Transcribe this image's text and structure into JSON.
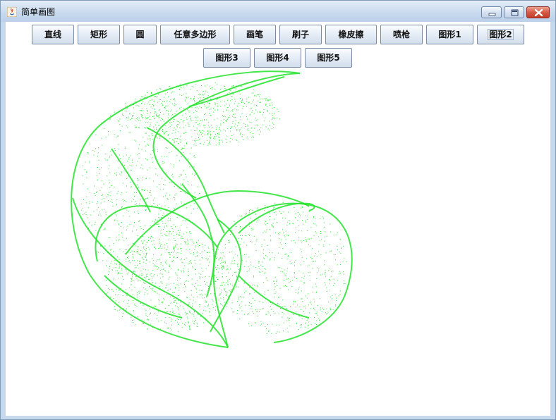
{
  "window": {
    "title": "简单画图",
    "controls": [
      "minimize-icon",
      "maximize-icon",
      "close-icon"
    ]
  },
  "toolbar": {
    "row1": [
      "直线",
      "矩形",
      "圆",
      "任意多边形",
      "画笔",
      "刷子",
      "橡皮擦",
      "喷枪",
      "图形1",
      "图形2"
    ],
    "row2": [
      "图形3",
      "图形4",
      "图形5"
    ],
    "focused": "图形2"
  },
  "canvas": {
    "stroke_color": "#22e32a",
    "background": "#ffffff"
  }
}
